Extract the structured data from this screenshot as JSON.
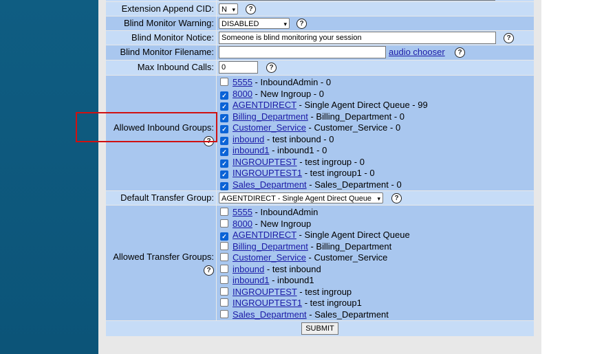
{
  "fields": {
    "extension_append_cid": {
      "label": "Extension Append CID:",
      "value": "N"
    },
    "blind_monitor_warning": {
      "label": "Blind Monitor Warning:",
      "value": "DISABLED"
    },
    "blind_monitor_notice": {
      "label": "Blind Monitor Notice:",
      "value": "Someone is blind monitoring your session"
    },
    "blind_monitor_filename": {
      "label": "Blind Monitor Filename:",
      "value": "",
      "link": "audio chooser"
    },
    "max_inbound_calls": {
      "label": "Max Inbound Calls:",
      "value": "0"
    },
    "allowed_inbound_groups": {
      "label": "Allowed Inbound Groups:"
    },
    "default_transfer_group": {
      "label": "Default Transfer Group:",
      "value": "AGENTDIRECT - Single Agent Direct Queue"
    },
    "allowed_transfer_groups": {
      "label": "Allowed Transfer Groups:"
    }
  },
  "help_glyph": "?",
  "inbound_groups": [
    {
      "id": "5555",
      "desc": " - InboundAdmin - 0",
      "checked": false
    },
    {
      "id": "8000",
      "desc": " - New Ingroup - 0",
      "checked": true
    },
    {
      "id": "AGENTDIRECT",
      "desc": " - Single Agent Direct Queue - 99",
      "checked": true
    },
    {
      "id": "Billing_Department",
      "desc": " - Billing_Department - 0",
      "checked": true
    },
    {
      "id": "Customer_Service",
      "desc": " - Customer_Service - 0",
      "checked": true
    },
    {
      "id": "inbound",
      "desc": " - test inbound - 0",
      "checked": true
    },
    {
      "id": "inbound1",
      "desc": " - inbound1 - 0",
      "checked": true
    },
    {
      "id": "INGROUPTEST",
      "desc": " - test ingroup - 0",
      "checked": true
    },
    {
      "id": "INGROUPTEST1",
      "desc": " - test ingroup1 - 0",
      "checked": true
    },
    {
      "id": "Sales_Department",
      "desc": " - Sales_Department - 0",
      "checked": true
    }
  ],
  "transfer_groups": [
    {
      "id": "5555",
      "desc": " - InboundAdmin",
      "checked": false
    },
    {
      "id": "8000",
      "desc": " - New Ingroup",
      "checked": false
    },
    {
      "id": "AGENTDIRECT",
      "desc": " - Single Agent Direct Queue",
      "checked": true
    },
    {
      "id": "Billing_Department",
      "desc": " - Billing_Department",
      "checked": false
    },
    {
      "id": "Customer_Service",
      "desc": " - Customer_Service",
      "checked": false
    },
    {
      "id": "inbound",
      "desc": " - test inbound",
      "checked": false
    },
    {
      "id": "inbound1",
      "desc": " - inbound1",
      "checked": false
    },
    {
      "id": "INGROUPTEST",
      "desc": " - test ingroup",
      "checked": false
    },
    {
      "id": "INGROUPTEST1",
      "desc": " - test ingroup1",
      "checked": false
    },
    {
      "id": "Sales_Department",
      "desc": " - Sales_Department",
      "checked": false
    }
  ],
  "submit_label": "SUBMIT",
  "colors": {
    "row_dark": "#a9c7ef",
    "row_light": "#c6dcf7",
    "sidebar": "#0f5d82",
    "highlight_box": "#d01010"
  }
}
